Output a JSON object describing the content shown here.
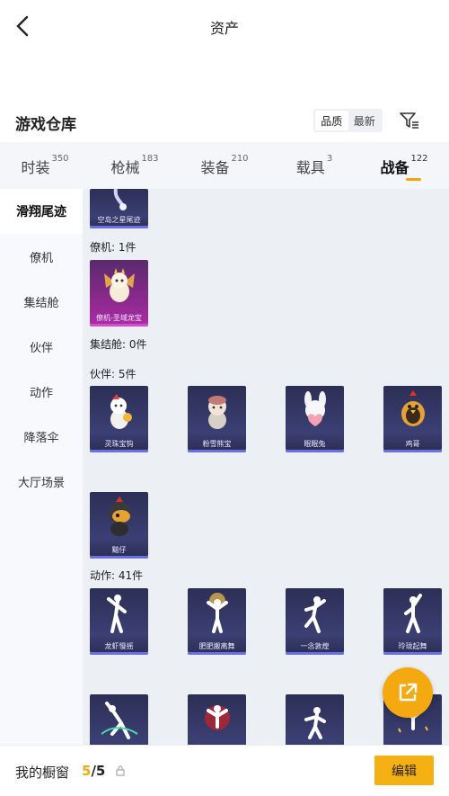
{
  "header": {
    "title": "资产"
  },
  "section": {
    "title": "游戏仓库",
    "sort_options": [
      "品质",
      "最新"
    ]
  },
  "tabs": [
    {
      "label": "时装",
      "count": "350"
    },
    {
      "label": "枪械",
      "count": "183"
    },
    {
      "label": "装备",
      "count": "210"
    },
    {
      "label": "载具",
      "count": "3"
    },
    {
      "label": "战备",
      "count": "122"
    }
  ],
  "sidebar": {
    "items": [
      "滑翔尾迹",
      "僚机",
      "集结舱",
      "伙伴",
      "动作",
      "降落伞",
      "大厅场景"
    ]
  },
  "content": {
    "top_item": {
      "name": "空岛之星尾迹"
    },
    "groups": {
      "wingman": {
        "label": "僚机: 1件",
        "items": [
          "僚机-圣域龙宝"
        ]
      },
      "capsule": {
        "label": "集结舱: 0件"
      },
      "partner": {
        "label": "伙伴: 5件",
        "items": [
          "灵珠宝钩",
          "粉雪熊宝",
          "眠眠兔",
          "鸡哥",
          "黯仔"
        ]
      },
      "action": {
        "label": "动作: 41件",
        "items": [
          "龙虾慢摇",
          "肥肥搬离舞",
          "一念敦煌",
          "玲珑起舞"
        ]
      }
    }
  },
  "bottom": {
    "label": "我的橱窗",
    "current": "5",
    "total": "/5",
    "edit_label": "编辑"
  },
  "colors": {
    "accent": "#f5a910",
    "card_bg": "#2c2f55",
    "card_rare": "#b02aa6"
  }
}
